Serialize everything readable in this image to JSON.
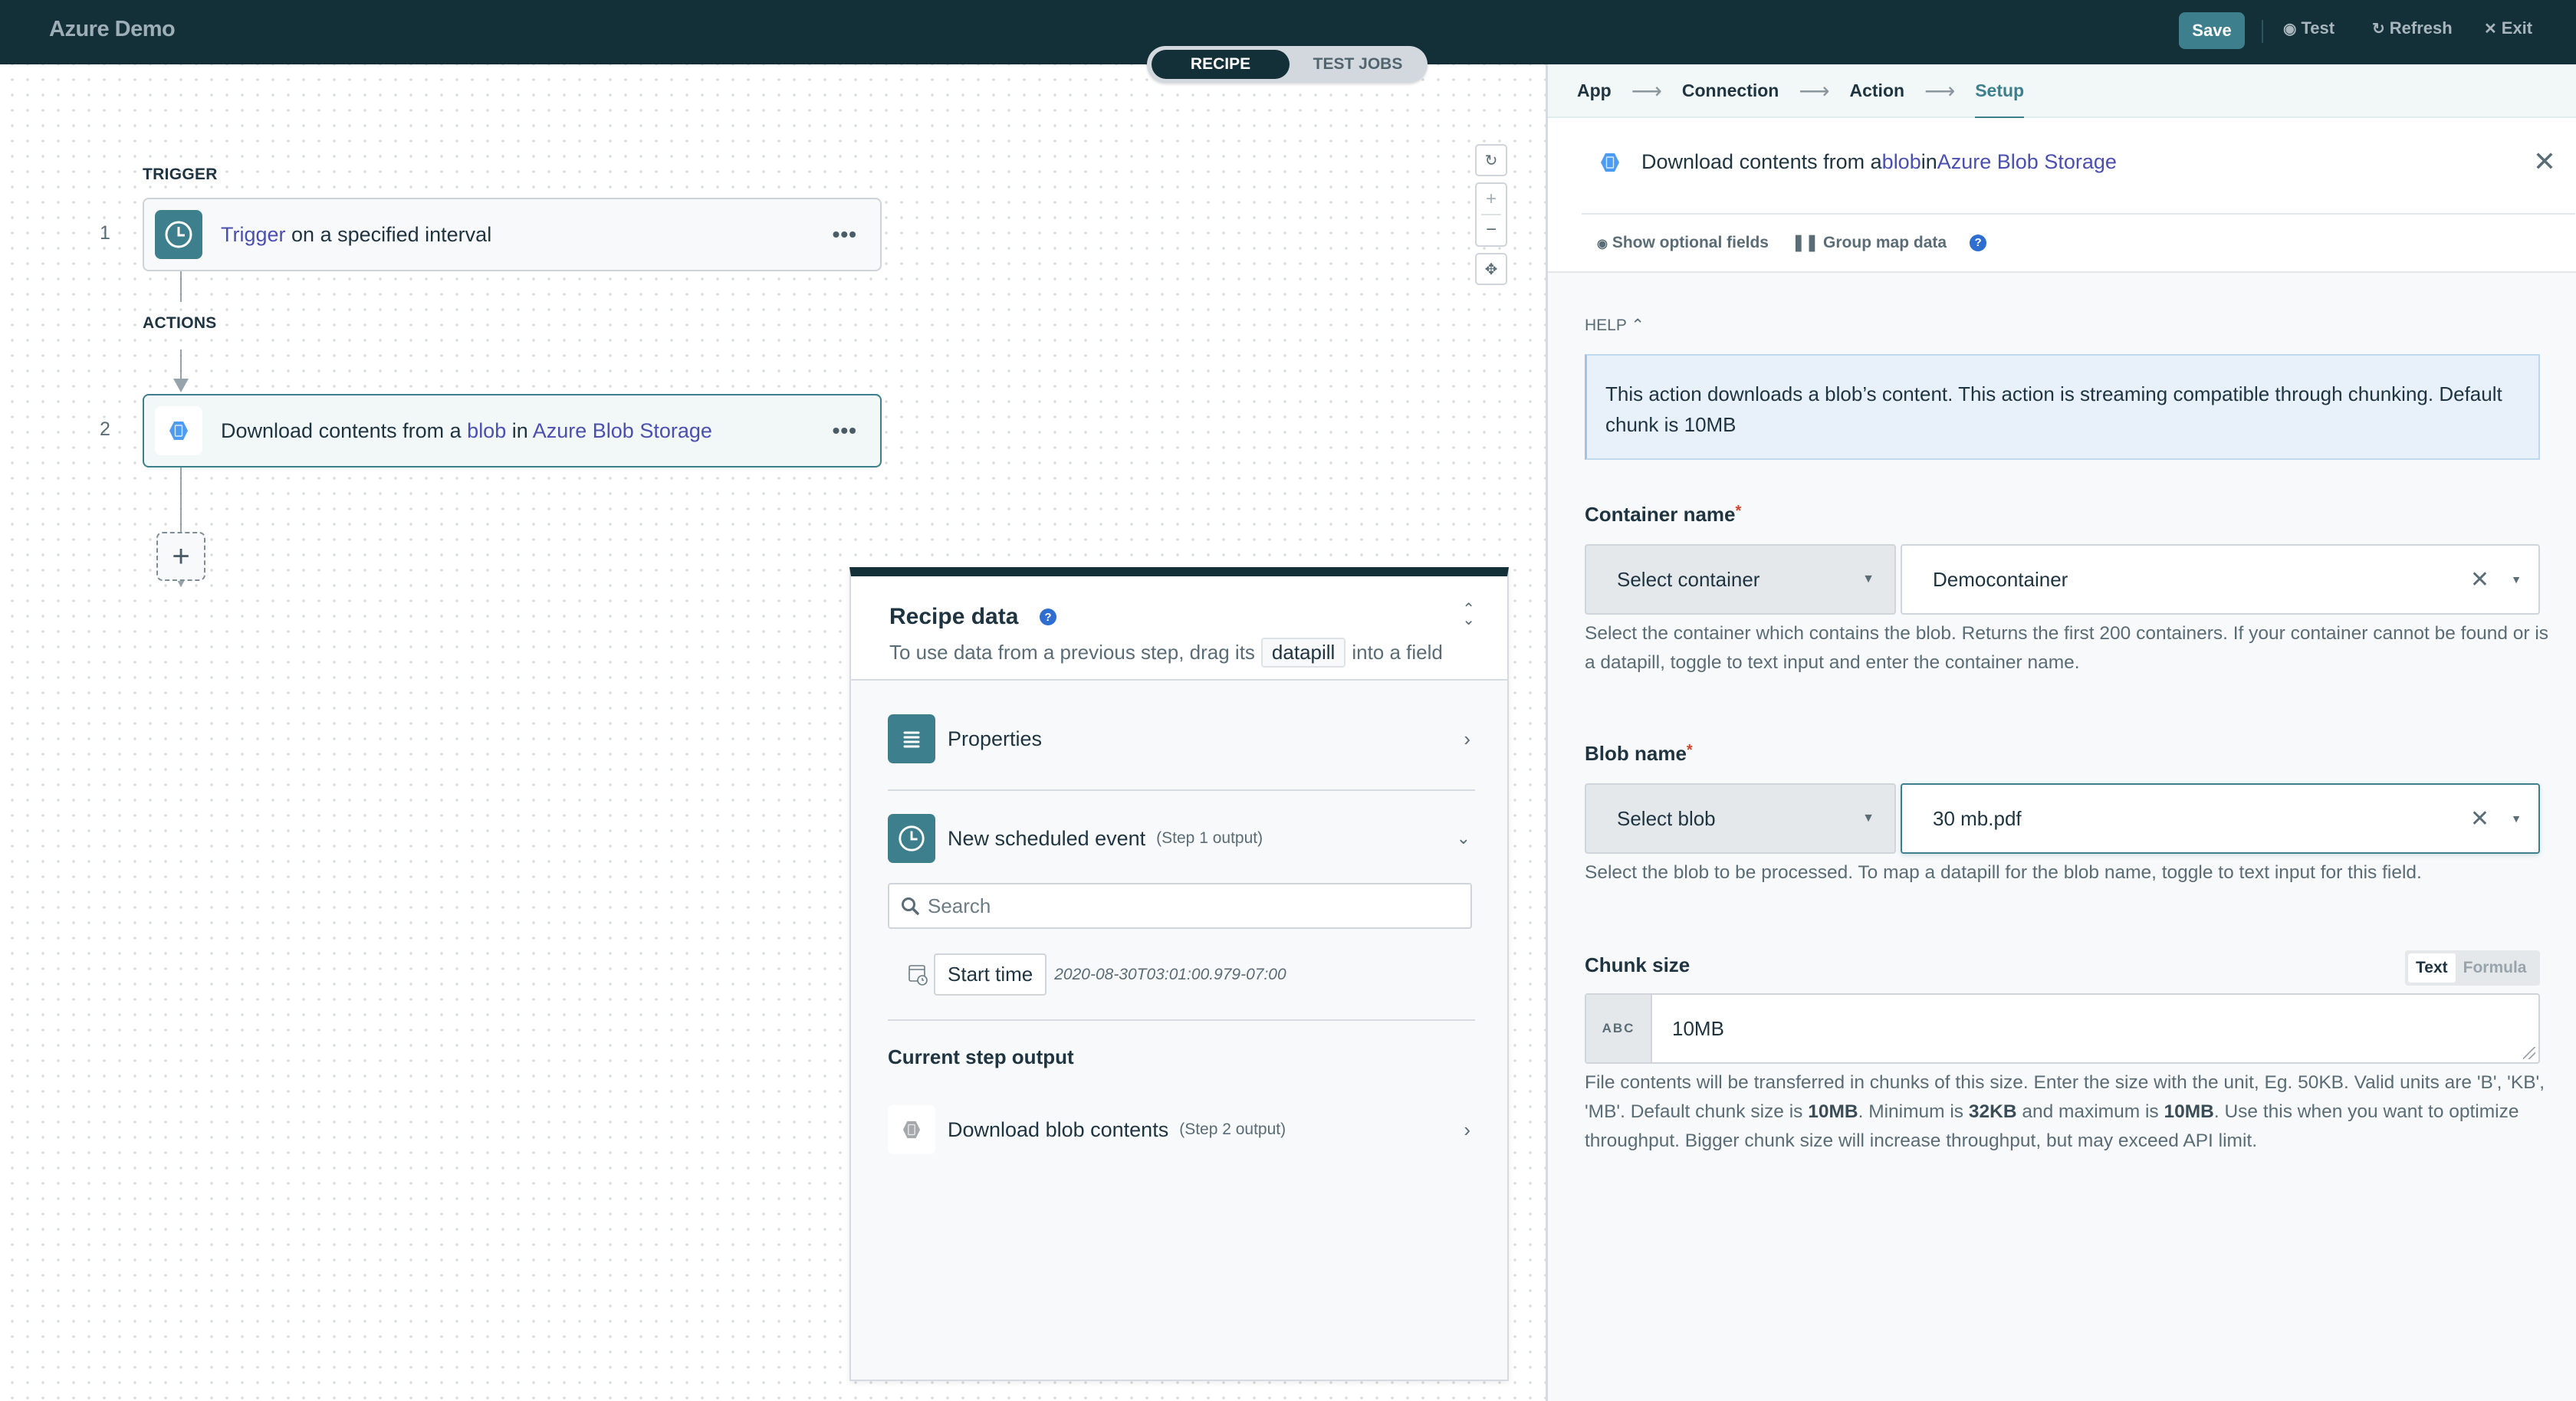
{
  "topbar": {
    "title": "Azure Demo",
    "save_label": "Save",
    "test_label": "Test",
    "refresh_label": "Refresh",
    "exit_label": "Exit"
  },
  "mode_toggle": {
    "options": [
      "RECIPE",
      "TEST JOBS"
    ],
    "selected": "RECIPE"
  },
  "canvas": {
    "trigger_section": "TRIGGER",
    "actions_section": "ACTIONS",
    "steps": [
      {
        "number": "1",
        "link": "Trigger",
        "text": " on a specified interval",
        "icon": "clock-icon"
      },
      {
        "number": "2",
        "prefix": "Download contents from a ",
        "link1": "blob",
        "mid": " in ",
        "link2": "Azure Blob Storage",
        "icon": "azure-blob-icon"
      }
    ],
    "more_label": "•••",
    "add_label": "+"
  },
  "zoom_controls": {
    "reset_icon": "↻",
    "zoom_in": "+",
    "zoom_out": "−",
    "fit_icon": "✥"
  },
  "recipe_data": {
    "title": "Recipe data",
    "help": "?",
    "subtitle_before": "To use data from a previous step, drag its",
    "pill": "datapill",
    "subtitle_after": "into a field",
    "properties_label": "Properties",
    "scheduled_label": "New scheduled event",
    "scheduled_sub": "(Step 1 output)",
    "search_placeholder": "Search",
    "start_time_label": "Start time",
    "start_time_value": "2020-08-30T03:01:00.979-07:00",
    "current_output_title": "Current step output",
    "download_label": "Download blob contents",
    "download_sub": "(Step 2 output)"
  },
  "setup": {
    "breadcrumb": [
      "App",
      "Connection",
      "Action",
      "Setup"
    ],
    "active_breadcrumb": "Setup",
    "action_prefix": "Download contents from a ",
    "action_link1": "blob",
    "action_mid": " in ",
    "action_link2": "Azure Blob Storage",
    "show_optional": "Show optional fields",
    "group_map": "Group map data",
    "help_label": "HELP",
    "help_text": "This action downloads a blob’s content. This action is streaming compatible through chunking. Default chunk is 10MB",
    "container": {
      "label": "Container name",
      "required": "*",
      "mode": "Select container",
      "value": "Democontainer",
      "hint": "Select the container which contains the blob. Returns the first 200 containers. If your container cannot be found or is a datapill, toggle to text input and enter the container name."
    },
    "blob": {
      "label": "Blob name",
      "required": "*",
      "mode": "Select blob",
      "value": "30 mb.pdf",
      "hint": "Select the blob to be processed. To map a datapill for the blob name, toggle to text input for this field."
    },
    "chunk": {
      "label": "Chunk size",
      "toggle_text": "Text",
      "toggle_formula": "Formula",
      "type_badge": "ABC",
      "value": "10MB",
      "hint_1": "File contents will be transferred in chunks of this size. Enter the size with the unit, Eg. 50KB. Valid units are 'B', 'KB', 'MB'. Default chunk size is ",
      "hint_b1": "10MB",
      "hint_2": ". Minimum is ",
      "hint_b2": "32KB",
      "hint_3": " and maximum is ",
      "hint_b3": "10MB",
      "hint_4": ". Use this when you want to optimize throughput. Bigger chunk size will increase throughput, but may exceed API limit."
    }
  }
}
